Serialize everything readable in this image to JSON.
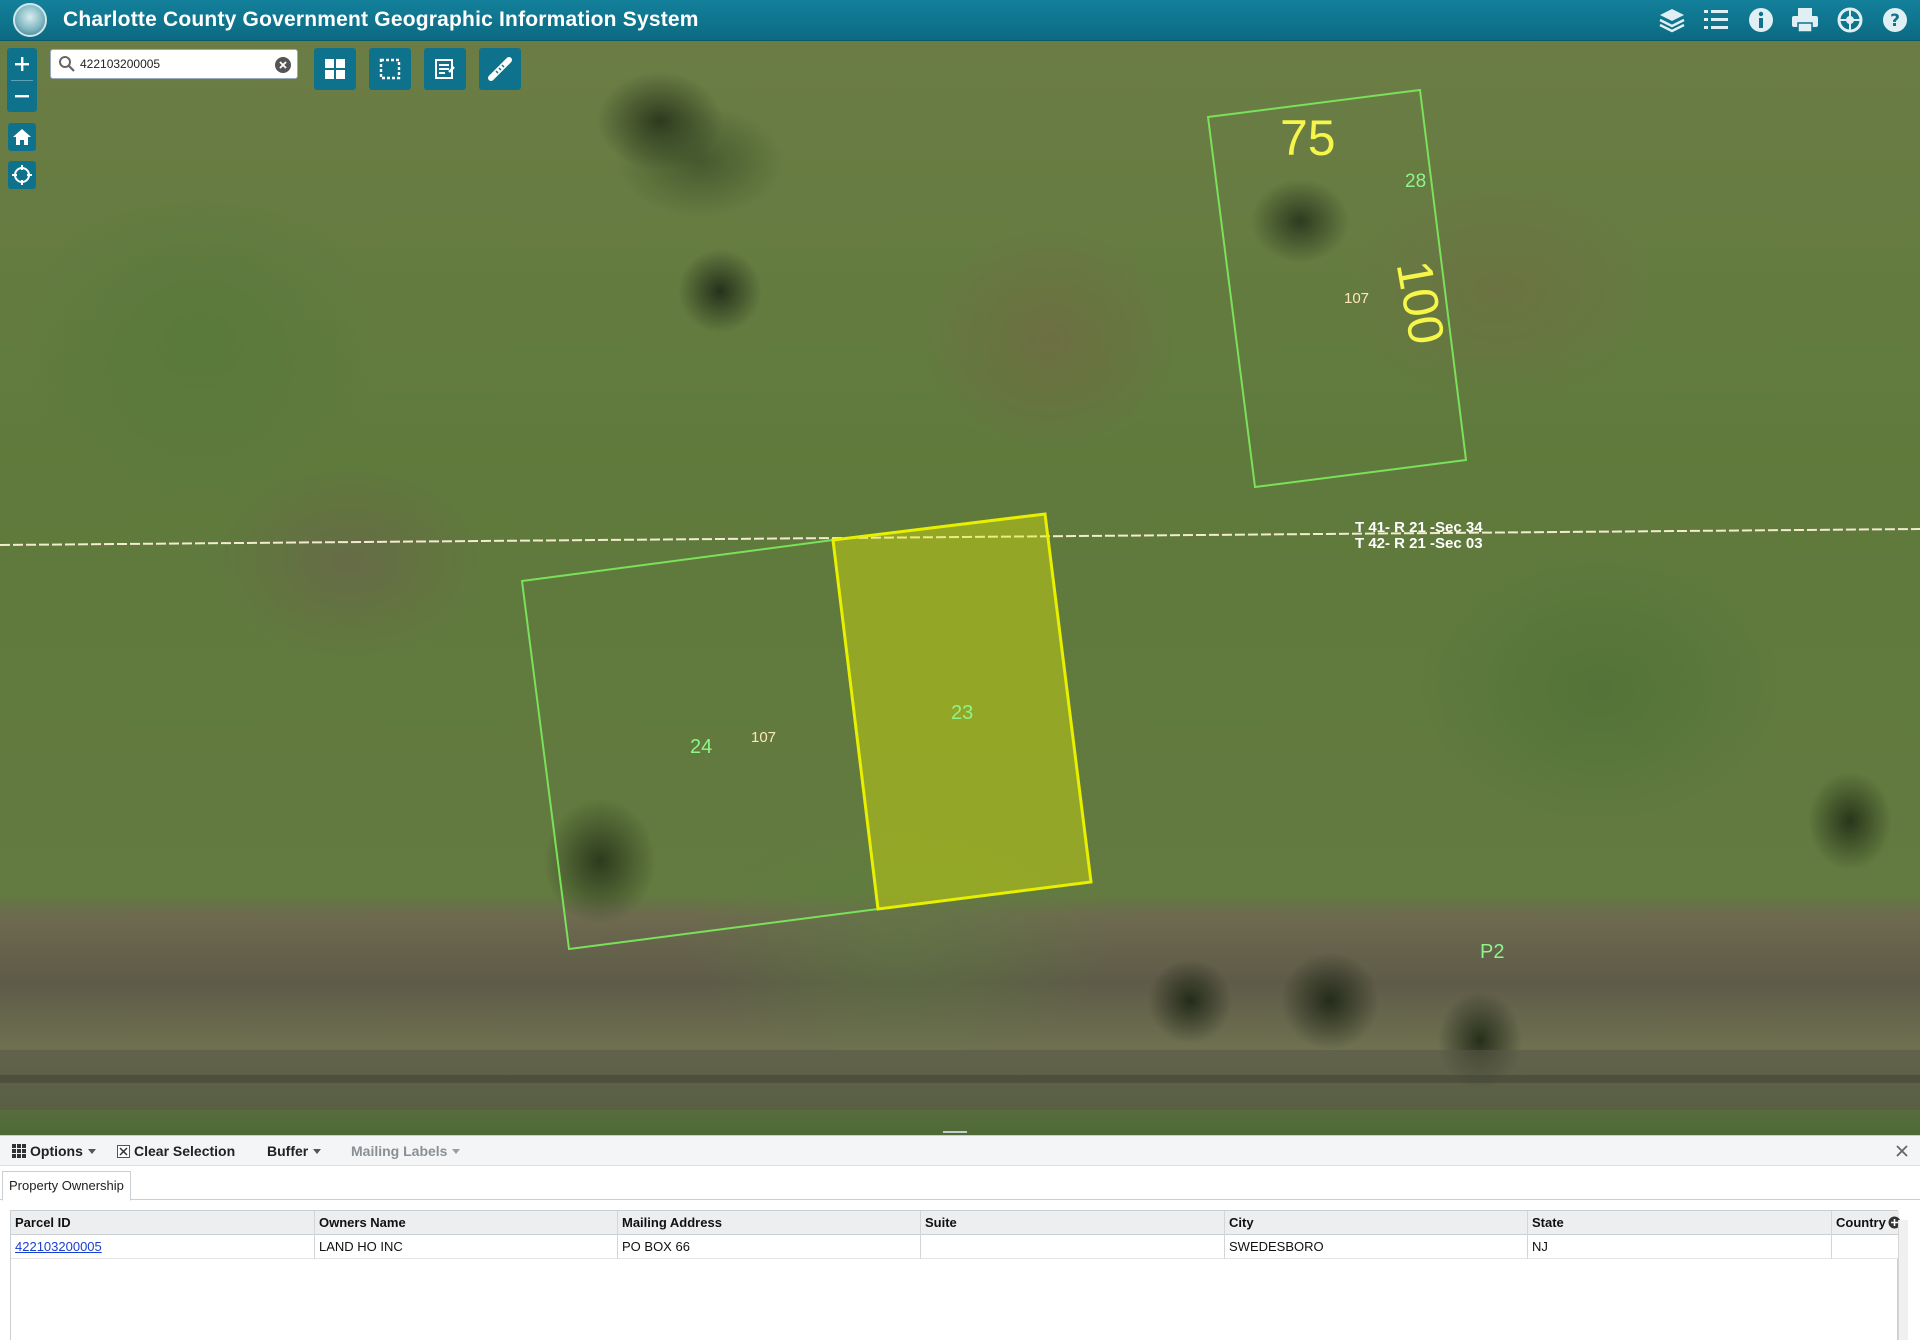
{
  "header": {
    "title": "Charlotte County Government Geographic Information System",
    "icons": [
      "layers-icon",
      "legend-list-icon",
      "info-icon",
      "print-icon",
      "tools-icon",
      "help-icon"
    ]
  },
  "search": {
    "value": "422103200005",
    "placeholder": ""
  },
  "map_labels": {
    "parcel_75_front": "75",
    "parcel_28": "28",
    "parcel_100_depth": "100",
    "block_107_top": "107",
    "section_line_upper": "T 41- R 21 -Sec 34",
    "section_line_lower": "T 42- R 21 -Sec 03",
    "parcel_23": "23",
    "parcel_24": "24",
    "block_107_bottom": "107",
    "p2_label": "P2"
  },
  "colors": {
    "header": "#0f728c",
    "parcel_outline": "#7be05a",
    "selected_parcel": "#e8f000",
    "label_green": "#8ef58a",
    "label_yellow": "#f5f54a"
  },
  "panel": {
    "toolbar": {
      "options": "Options",
      "clear_selection": "Clear Selection",
      "buffer": "Buffer",
      "mailing_labels": "Mailing Labels"
    },
    "tab": "Property Ownership",
    "columns": [
      "Parcel ID",
      "Owners Name",
      "Mailing Address",
      "Suite",
      "City",
      "State",
      "Country"
    ],
    "rows": [
      [
        "422103200005",
        "LAND HO INC",
        "PO BOX 66",
        "",
        "SWEDESBORO",
        "NJ",
        ""
      ]
    ]
  }
}
